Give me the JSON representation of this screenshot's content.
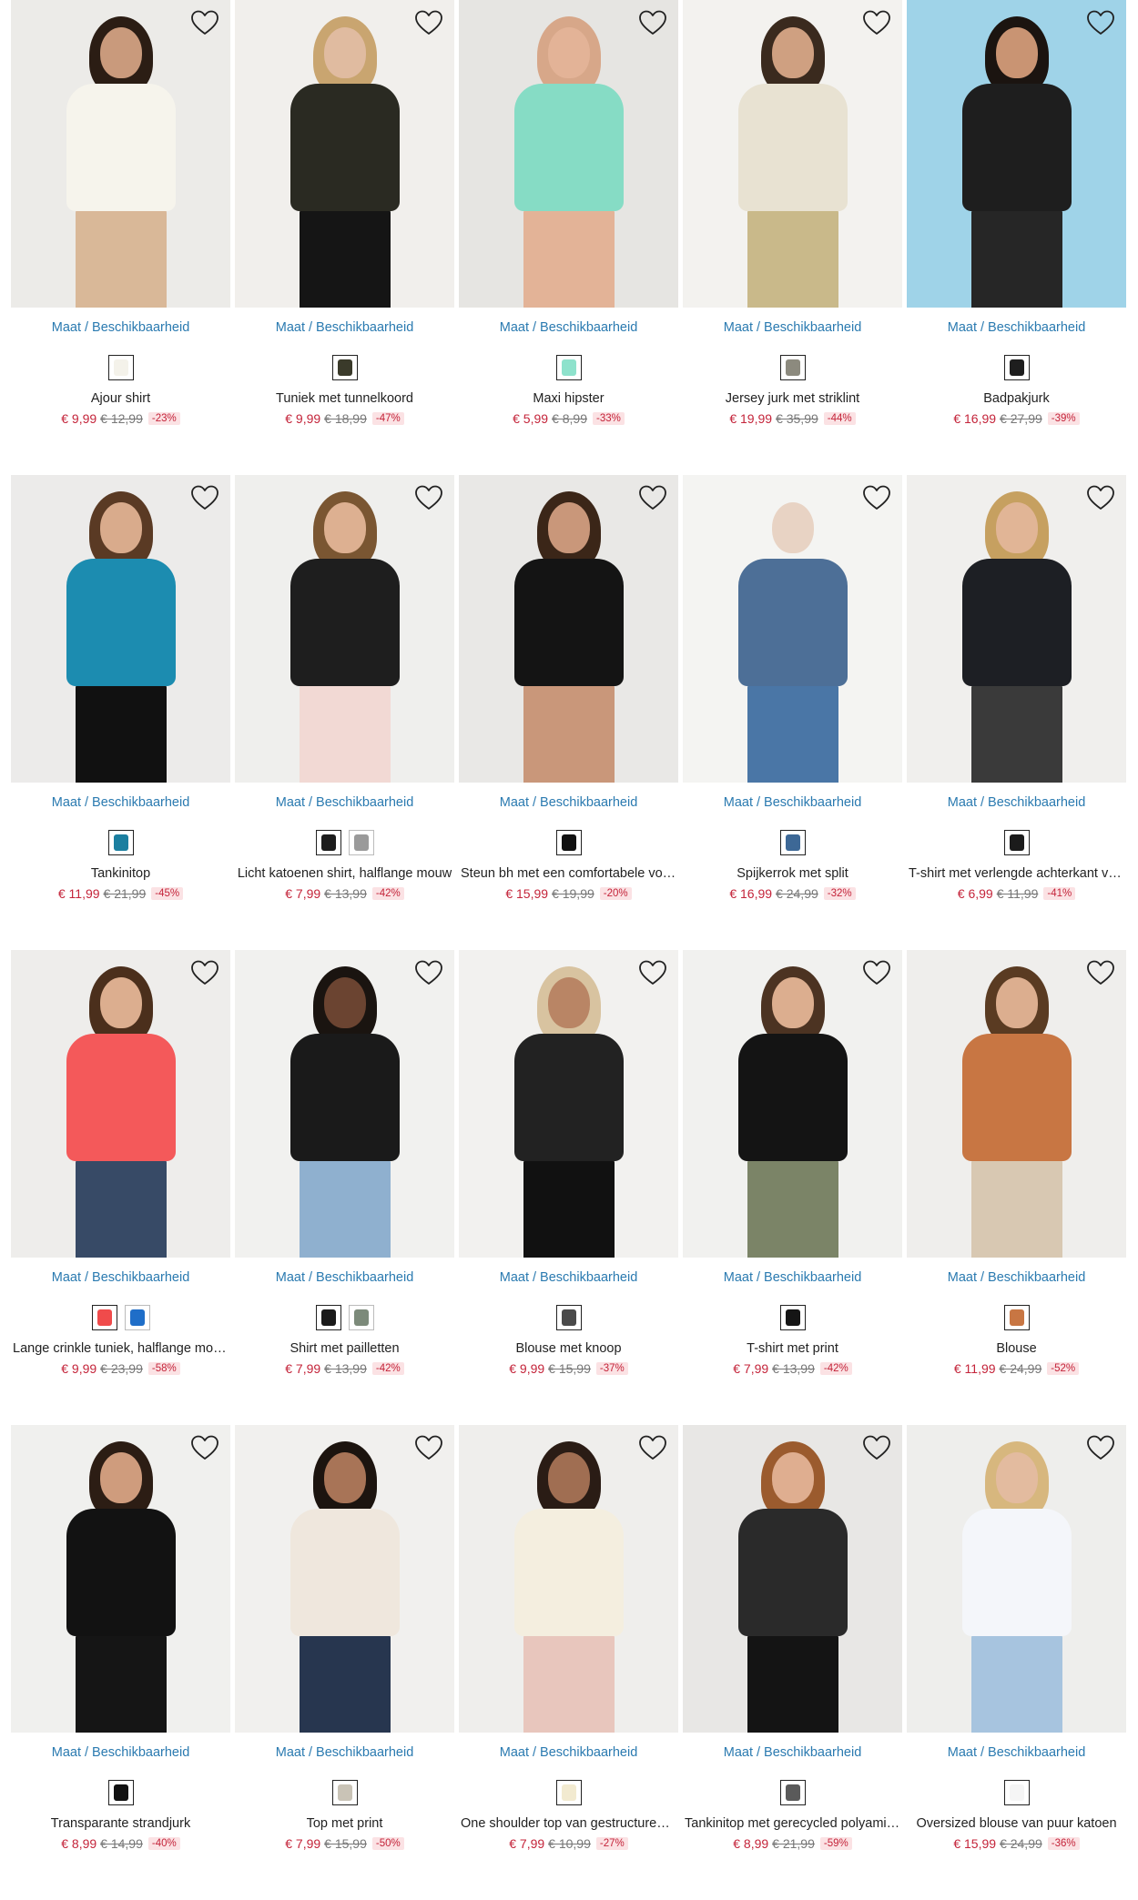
{
  "availability_label": "Maat / Beschikbaarheid",
  "products": [
    {
      "name": "Ajour shirt",
      "price": "€ 9,99",
      "old_price": "€ 12,99",
      "discount": "-23%",
      "swatches": [
        "#f4f2ea"
      ],
      "colors": {
        "bg": "#ecebe8",
        "hair": "#2b1d14",
        "skin": "#c99a7c",
        "top": "#f6f4ec",
        "bottom": "#d9b898"
      }
    },
    {
      "name": "Tuniek met tunnelkoord",
      "price": "€ 9,99",
      "old_price": "€ 18,99",
      "discount": "-47%",
      "swatches": [
        "#3a3a2a"
      ],
      "colors": {
        "bg": "#f1efec",
        "hair": "#c9a570",
        "skin": "#e0bba0",
        "top": "#2a2a22",
        "bottom": "#151515"
      }
    },
    {
      "name": "Maxi hipster",
      "price": "€ 5,99",
      "old_price": "€ 8,99",
      "discount": "-33%",
      "swatches": [
        "#8ee2cc"
      ],
      "colors": {
        "bg": "#e6e5e2",
        "hair": "#d7a789",
        "skin": "#e3b397",
        "top": "#86dcc5",
        "bottom": "#e3b397"
      }
    },
    {
      "name": "Jersey jurk met striklint",
      "price": "€ 19,99",
      "old_price": "€ 35,99",
      "discount": "-44%",
      "swatches": [
        "#8c8a7e"
      ],
      "colors": {
        "bg": "#f3f2ef",
        "hair": "#3a2a1e",
        "skin": "#cfa081",
        "top": "#e8e2d2",
        "bottom": "#c9b98a"
      }
    },
    {
      "name": "Badpakjurk",
      "price": "€ 16,99",
      "old_price": "€ 27,99",
      "discount": "-39%",
      "swatches": [
        "#1e1e1e"
      ],
      "colors": {
        "bg": "#9fd3e8",
        "hair": "#1b1410",
        "skin": "#c99473",
        "top": "#1e1e1e",
        "bottom": "#262626"
      }
    },
    {
      "name": "Tankinitop",
      "price": "€ 11,99",
      "old_price": "€ 21,99",
      "discount": "-45%",
      "swatches": [
        "#1b7fa0"
      ],
      "colors": {
        "bg": "#ecebea",
        "hair": "#5a3a24",
        "skin": "#d9ab8c",
        "top": "#1c8cb0",
        "bottom": "#111"
      }
    },
    {
      "name": "Licht katoenen shirt, halflange mouw",
      "price": "€ 7,99",
      "old_price": "€ 13,99",
      "discount": "-42%",
      "swatches": [
        "#1c1c1c",
        "#9a9a9a"
      ],
      "colors": {
        "bg": "#efefed",
        "hair": "#7a5632",
        "skin": "#ddb091",
        "top": "#1e1e1e",
        "bottom": "#f2d9d4"
      }
    },
    {
      "name": "Steun bh met een comfortabele voorsluiting",
      "price": "€ 15,99",
      "old_price": "€ 19,99",
      "discount": "-20%",
      "swatches": [
        "#111111"
      ],
      "colors": {
        "bg": "#e9e8e6",
        "hair": "#3b2618",
        "skin": "#c9977a",
        "top": "#141414",
        "bottom": "#c9977a"
      }
    },
    {
      "name": "Spijkerrok met split",
      "price": "€ 16,99",
      "old_price": "€ 24,99",
      "discount": "-32%",
      "swatches": [
        "#3d6896"
      ],
      "colors": {
        "bg": "#f4f4f2",
        "hair": "#f4f4f2",
        "skin": "#e8d3c4",
        "top": "#4d6f97",
        "bottom": "#4a76a6"
      }
    },
    {
      "name": "T-shirt met verlengde achterkant voor",
      "price": "€ 6,99",
      "old_price": "€ 11,99",
      "discount": "-41%",
      "swatches": [
        "#1b1b1b"
      ],
      "colors": {
        "bg": "#f0efed",
        "hair": "#c6a060",
        "skin": "#e1b596",
        "top": "#1d1f24",
        "bottom": "#3a3a3a"
      }
    },
    {
      "name": "Lange crinkle tuniek, halflange mouw",
      "price": "€ 9,99",
      "old_price": "€ 23,99",
      "discount": "-58%",
      "swatches": [
        "#f04b4b",
        "#1f6ec8"
      ],
      "colors": {
        "bg": "#eeedeb",
        "hair": "#4b2f1c",
        "skin": "#dcae8f",
        "top": "#f4595a",
        "bottom": "#374a66"
      }
    },
    {
      "name": "Shirt met pailletten",
      "price": "€ 7,99",
      "old_price": "€ 13,99",
      "discount": "-42%",
      "swatches": [
        "#1a1a1a",
        "#7c8a7a"
      ],
      "colors": {
        "bg": "#f1f1ef",
        "hair": "#1a1410",
        "skin": "#6b4431",
        "top": "#1a1a1a",
        "bottom": "#8fb0cf"
      }
    },
    {
      "name": "Blouse met knoop",
      "price": "€ 9,99",
      "old_price": "€ 15,99",
      "discount": "-37%",
      "swatches": [
        "#4a4a4a"
      ],
      "colors": {
        "bg": "#f2f1ef",
        "hair": "#d8c3a0",
        "skin": "#b98565",
        "top": "#222",
        "bottom": "#111"
      }
    },
    {
      "name": "T-shirt met print",
      "price": "€ 7,99",
      "old_price": "€ 13,99",
      "discount": "-42%",
      "swatches": [
        "#151515"
      ],
      "colors": {
        "bg": "#f1f1ef",
        "hair": "#4c3322",
        "skin": "#dcae8f",
        "top": "#141414",
        "bottom": "#7b8467"
      }
    },
    {
      "name": "Blouse",
      "price": "€ 11,99",
      "old_price": "€ 24,99",
      "discount": "-52%",
      "swatches": [
        "#c87643"
      ],
      "colors": {
        "bg": "#efeeec",
        "hair": "#5a3b22",
        "skin": "#dcae8f",
        "top": "#c87643",
        "bottom": "#d8c8b2"
      }
    },
    {
      "name": "Transparante strandjurk",
      "price": "€ 8,99",
      "old_price": "€ 14,99",
      "discount": "-40%",
      "swatches": [
        "#111111"
      ],
      "colors": {
        "bg": "#f0f0ee",
        "hair": "#2c1d14",
        "skin": "#cf9c7d",
        "top": "#121212",
        "bottom": "#151515"
      }
    },
    {
      "name": "Top met print",
      "price": "€ 7,99",
      "old_price": "€ 15,99",
      "discount": "-50%",
      "swatches": [
        "#c9c3b6"
      ],
      "colors": {
        "bg": "#f1f0ee",
        "hair": "#1c140f",
        "skin": "#a87457",
        "top": "#efe7dd",
        "bottom": "#27364f"
      }
    },
    {
      "name": "One shoulder top van gestructureerde jersey",
      "price": "€ 7,99",
      "old_price": "€ 10,99",
      "discount": "-27%",
      "swatches": [
        "#f2ead0"
      ],
      "colors": {
        "bg": "#efeeec",
        "hair": "#2a1c15",
        "skin": "#a06e52",
        "top": "#f4eedf",
        "bottom": "#e8c6bd"
      }
    },
    {
      "name": "Tankinitop met gerecycled polyamide",
      "price": "€ 8,99",
      "old_price": "€ 21,99",
      "discount": "-59%",
      "swatches": [
        "#5a5a5a"
      ],
      "colors": {
        "bg": "#e8e7e5",
        "hair": "#9b5b2e",
        "skin": "#dfae90",
        "top": "#2a2a2a",
        "bottom": "#141414"
      }
    },
    {
      "name": "Oversized blouse van puur katoen",
      "price": "€ 15,99",
      "old_price": "€ 24,99",
      "discount": "-36%",
      "swatches": [
        "#f5f5f5"
      ],
      "colors": {
        "bg": "#eeeeec",
        "hair": "#d7b77e",
        "skin": "#e3bb9f",
        "top": "#f4f6fa",
        "bottom": "#a7c4df"
      }
    }
  ]
}
